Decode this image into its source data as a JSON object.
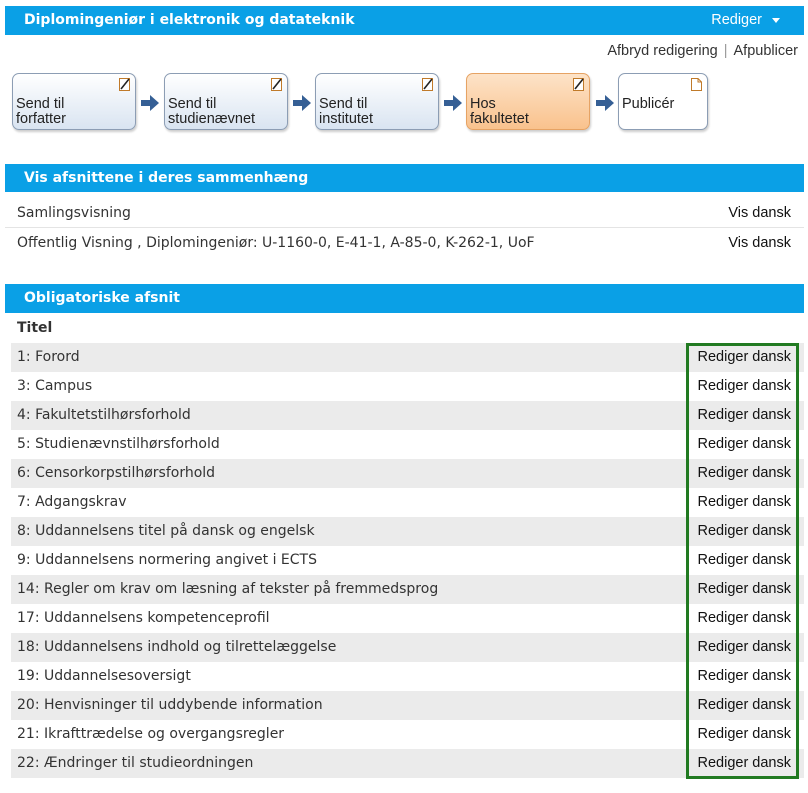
{
  "header": {
    "title": "Diplomingeniør i elektronik og datateknik",
    "rediger_label": "Rediger"
  },
  "actions": {
    "cancel_edit": "Afbryd redigering",
    "separator": "|",
    "unpublish": "Afpublicer"
  },
  "workflow": {
    "steps": [
      {
        "line1": "Send til",
        "line2": "forfatter",
        "icon": "edit-document-icon"
      },
      {
        "line1": "Send til",
        "line2": "studienævnet",
        "icon": "edit-document-icon"
      },
      {
        "line1": "Send til",
        "line2": "institutet",
        "icon": "edit-document-icon"
      },
      {
        "line1": "Hos",
        "line2": "fakultetet",
        "icon": "edit-document-icon",
        "state": "current"
      },
      {
        "line1": "Publicér",
        "line2": "",
        "icon": "document-icon"
      }
    ],
    "colors": {
      "step": "#d9e4f1",
      "current": "#f9c28d",
      "arrow": "#355f95"
    }
  },
  "views_section": {
    "title": "Vis afsnittene i deres sammenhæng",
    "rows": [
      {
        "label": "Samlingsvisning",
        "link": "Vis dansk"
      },
      {
        "label": "Offentlig Visning , Diplomingeniør: U-1160-0, E-41-1, A-85-0, K-262-1, UoF",
        "link": "Vis dansk"
      }
    ]
  },
  "mandatory_section": {
    "title": "Obligatoriske afsnit",
    "column_header": "Titel",
    "edit_label": "Rediger dansk",
    "rows": [
      "1: Forord",
      "3: Campus",
      "4: Fakultetstilhørsforhold",
      "5: Studienævnstilhørsforhold",
      "6: Censorkorpstilhørsforhold",
      "7: Adgangskrav",
      "8: Uddannelsens titel på dansk og engelsk",
      "9: Uddannelsens normering angivet i ECTS",
      "14: Regler om krav om læsning af tekster på fremmedsprog",
      "17: Uddannelsens kompetenceprofil",
      "18: Uddannelsens indhold og tilrettelæggelse",
      "19: Uddannelsesoversigt",
      "20: Henvisninger til uddybende information",
      "21: Ikrafttrædelse og overgangsregler",
      "22: Ændringer til studieordningen"
    ]
  },
  "colors": {
    "header_bar": "#0aa0e6",
    "highlight_frame": "#217a21",
    "row_stripe": "#ebebeb"
  }
}
